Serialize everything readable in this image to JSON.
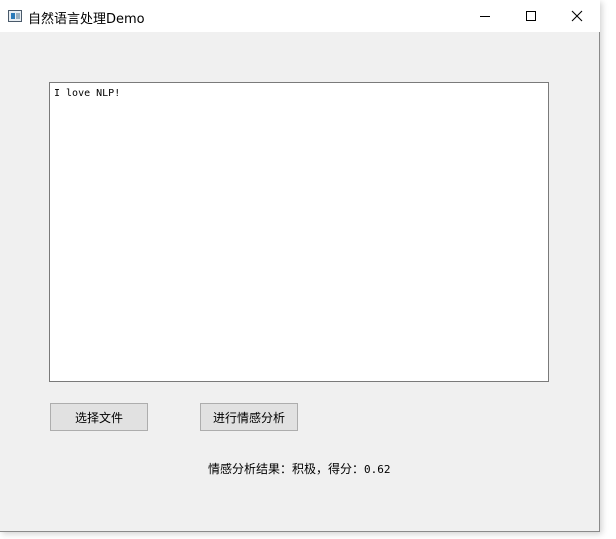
{
  "window": {
    "title": "自然语言处理Demo",
    "icon": "app-window-icon",
    "controls": {
      "minimize": "minimize-icon",
      "maximize": "maximize-icon",
      "close": "close-icon"
    }
  },
  "editor": {
    "text": "I love NLP!"
  },
  "buttons": {
    "select_file": "选择文件",
    "analyze_sentiment": "进行情感分析"
  },
  "result": {
    "label": "情感分析结果：积极，得分：",
    "score": "0.62"
  }
}
